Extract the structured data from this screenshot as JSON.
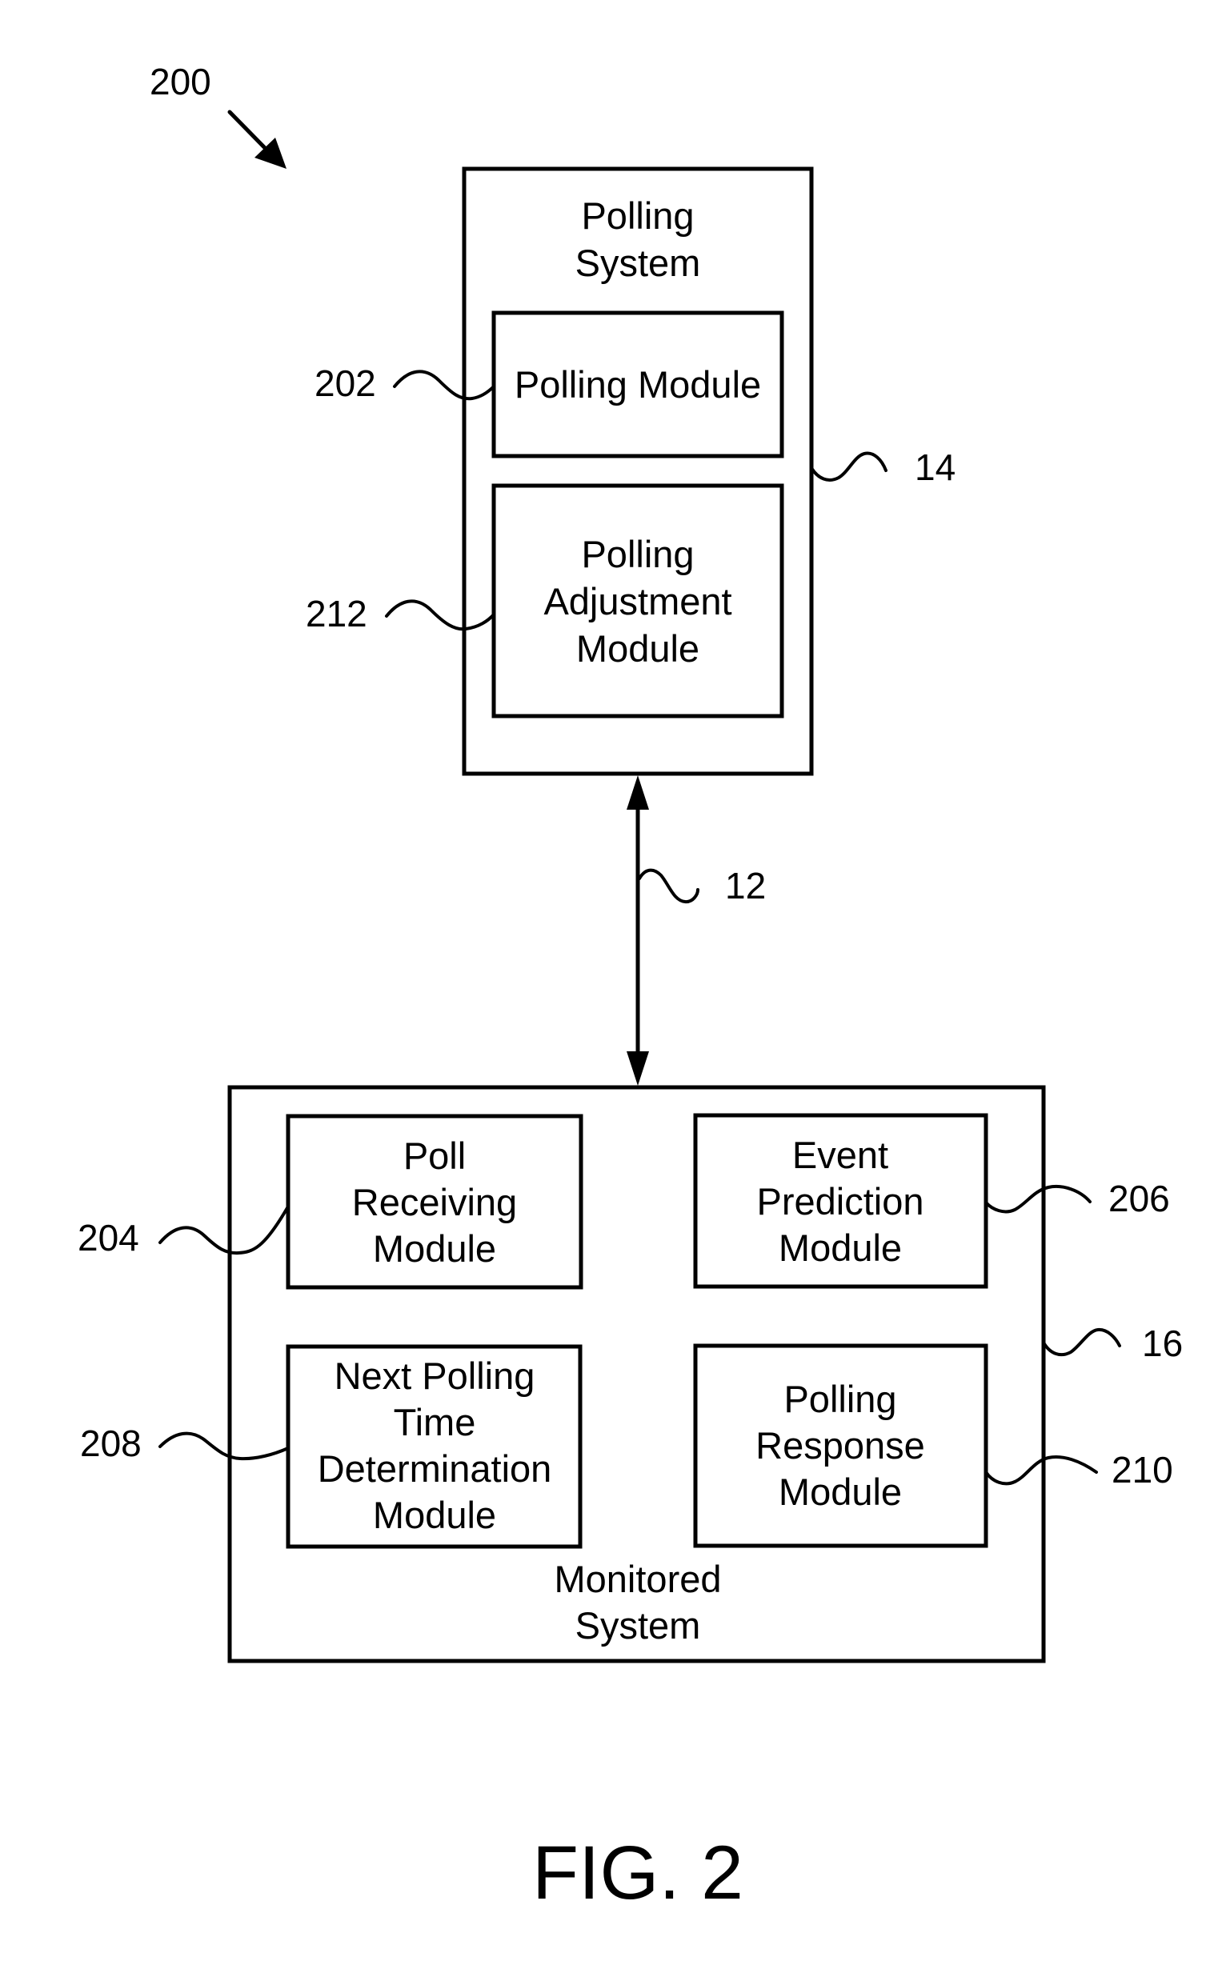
{
  "figure": {
    "number_label": "200",
    "caption": "FIG. 2"
  },
  "polling_system": {
    "ref": "14",
    "title_lines": [
      "Polling",
      "System"
    ],
    "modules": [
      {
        "ref": "202",
        "lines": [
          "Polling Module"
        ]
      },
      {
        "ref": "212",
        "lines": [
          "Polling",
          "Adjustment",
          "Module"
        ]
      }
    ]
  },
  "connection": {
    "ref": "12",
    "direction": "bidirectional"
  },
  "monitored_system": {
    "ref": "16",
    "title_lines": [
      "Monitored",
      "System"
    ],
    "modules": [
      {
        "ref": "204",
        "lines": [
          "Poll",
          "Receiving",
          "Module"
        ]
      },
      {
        "ref": "206",
        "lines": [
          "Event",
          "Prediction",
          "Module"
        ]
      },
      {
        "ref": "208",
        "lines": [
          "Next Polling",
          "Time",
          "Determination",
          "Module"
        ]
      },
      {
        "ref": "210",
        "lines": [
          "Polling",
          "Response",
          "Module"
        ]
      }
    ]
  }
}
